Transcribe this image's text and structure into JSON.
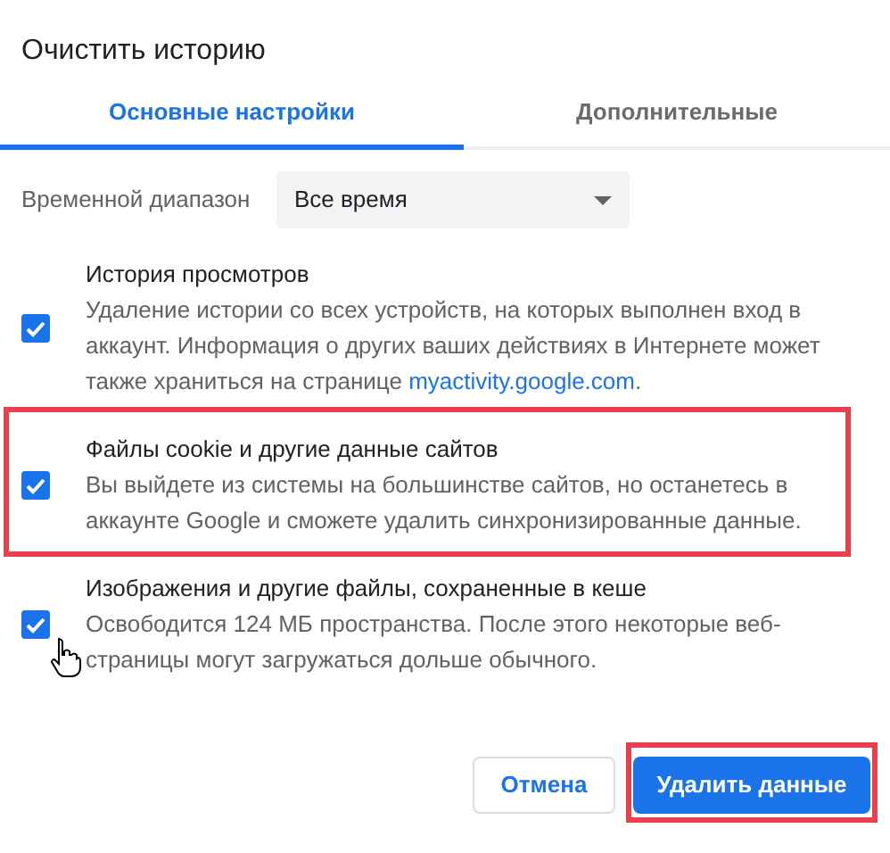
{
  "dialog": {
    "title": "Очистить историю"
  },
  "tabs": [
    {
      "label": "Основные настройки",
      "selected": true
    },
    {
      "label": "Дополнительные",
      "selected": false
    }
  ],
  "time_range": {
    "label": "Временной диапазон",
    "value": "Все время"
  },
  "items": [
    {
      "title": "История просмотров",
      "description": "Удаление истории со всех устройств, на которых выполнен вход в аккаунт. Информация о других ваших действиях в Интернете может также храниться на странице ",
      "link": "myactivity.google.com",
      "after_link": ".",
      "checked": true,
      "highlighted": false
    },
    {
      "title": "Файлы cookie и другие данные сайтов",
      "description": "Вы выйдете из системы на большинстве сайтов, но останетесь в аккаунте Google и сможете удалить синхронизированные данные.",
      "checked": true,
      "highlighted": true
    },
    {
      "title": "Изображения и другие файлы, сохраненные в кеше",
      "description": "Освободится 124 МБ пространства. После этого некоторые веб-страницы могут загружаться дольше обычного.",
      "checked": true,
      "highlighted": false,
      "cursor": true
    }
  ],
  "buttons": [
    {
      "label": "Отмена",
      "kind": "secondary",
      "highlighted": false
    },
    {
      "label": "Удалить данные",
      "kind": "primary",
      "highlighted": true
    }
  ]
}
